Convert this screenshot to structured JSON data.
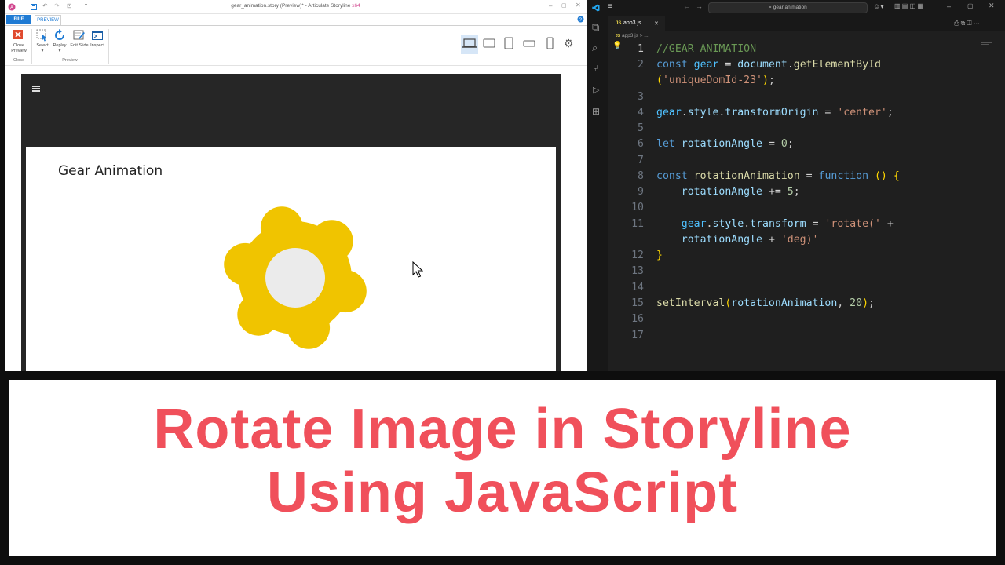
{
  "storyline": {
    "window_title": "gear_animation.story (Preview)* - Articulate Storyline",
    "arch": "x64",
    "tabs": {
      "file": "FILE",
      "preview": "PREVIEW"
    },
    "ribbon": {
      "close_preview": "Close Preview",
      "close_group": "Close",
      "select": "Select",
      "replay": "Replay",
      "edit_slide": "Edit Slide",
      "inspect": "Inspect",
      "preview_group": "Preview"
    },
    "slide_title": "Gear Animation",
    "gear_color": "#f0c400",
    "gear_center_color": "#ebebeb"
  },
  "vscode": {
    "search": "gear animation",
    "tab_label": "app3.js",
    "tab_icon": "JS",
    "breadcrumb": "app3.js > ...",
    "line_numbers": [
      "1",
      "2",
      "3",
      "4",
      "5",
      "6",
      "7",
      "8",
      "9",
      "10",
      "11",
      "12",
      "13",
      "14",
      "15",
      "16",
      "17"
    ],
    "code": {
      "l1": "//GEAR ANIMATION",
      "l2": [
        "const",
        "gear",
        "=",
        "document",
        ".",
        "getElementById"
      ],
      "l2b": "('uniqueDomId-23');",
      "l4": "gear.style.transformOrigin = 'center';",
      "l6": "let rotationAngle = 0;",
      "l8": "const rotationAnimation = function () {",
      "l9": "rotationAngle += 5;",
      "l11": "gear.style.transform = 'rotate(' +",
      "l11b": "rotationAngle + 'deg)'",
      "l12": "}",
      "l15": "setInterval(rotationAnimation, 20);"
    }
  },
  "banner": {
    "line1": "Rotate Image in Storyline",
    "line2": "Using JavaScript",
    "color": "#f0505b"
  }
}
